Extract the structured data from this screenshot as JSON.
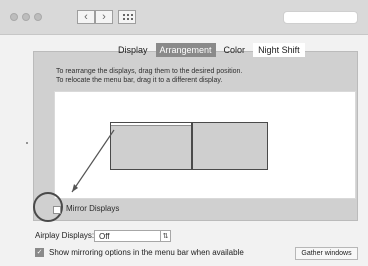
{
  "tabs": [
    {
      "label": "Display"
    },
    {
      "label": "Arrangement"
    },
    {
      "label": "Color"
    },
    {
      "label": "Night Shift"
    }
  ],
  "arrangement": {
    "instruction_1": "To rearrange the displays, drag them to the desired position.",
    "instruction_2": "To relocate the menu bar, drag it to a different display.",
    "mirror_label": "Mirror Displays"
  },
  "airplay": {
    "label": "Airplay Displays:",
    "value": "Off"
  },
  "menu_bar_option": {
    "label": "Show mirroring options in the menu bar when available"
  },
  "buttons": {
    "gather": "Gather windows"
  },
  "icons": {
    "back": "‹",
    "forward": "›",
    "dropdown": "⇅",
    "check": "✓"
  },
  "colors": {
    "selected_tab": "#8a8a8a",
    "panel": "#d0d0d0",
    "display": "#cfcfcf"
  }
}
